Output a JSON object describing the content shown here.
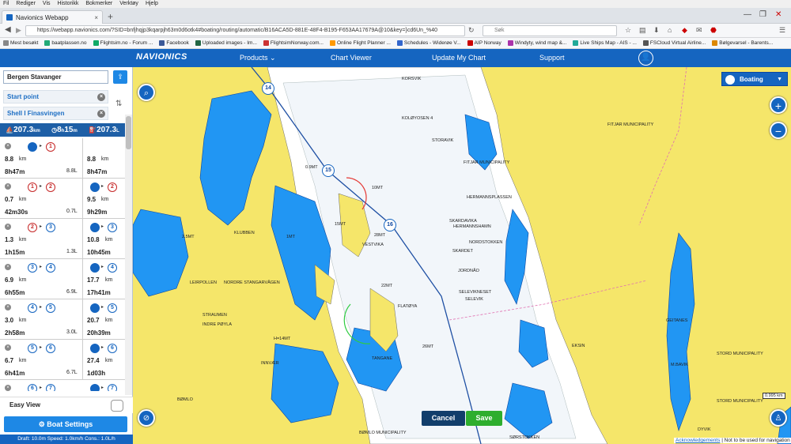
{
  "browser": {
    "menu": [
      "Fil",
      "Rediger",
      "Vis",
      "Historikk",
      "Bokmerker",
      "Verktøy",
      "Hjelp"
    ],
    "tab_title": "Navionics Webapp",
    "url": "https://webapp.navionics.com/?SID=bnfjhqjp3kqarpjh63m0d6otk4#boating/routing/automatic/B16ACA5D-881E-48F4-B195-F653AA17679A@10&key=}cd6Un_%40",
    "search_placeholder": "Søk",
    "bookmarks": [
      "Mest besøkt",
      "baatplassen.no",
      "Flightsim.no - Forum ...",
      "Facebook",
      "Uploaded images - Im...",
      "FlightsimNorway.com...",
      "Online Flight Planner ...",
      "Schedules - Widerøe V...",
      "AIP Norway",
      "Windyty, wind map &...",
      "Live Ships Map - AIS - ...",
      "FSCloud Virtual Airline...",
      "Bølgevarsel - Barents..."
    ]
  },
  "header": {
    "logo": "NAVIONICS",
    "nav": [
      "Products",
      "Chart Viewer",
      "Update My Chart",
      "Support"
    ]
  },
  "sidebar": {
    "route_name": "Bergen Stavanger",
    "start_point": "Start point",
    "end_point": "Shell I Finasvingen",
    "totals": {
      "distance": "207.3",
      "distance_unit": "km",
      "time_h": "8",
      "time_m": "15",
      "time_unit_h": "h",
      "fuel": "207.3",
      "fuel_unit": "L"
    },
    "legs": [
      {
        "from": "start",
        "to": "1",
        "dist": "8.8",
        "time": "8h47m",
        "fuel": "8.8L",
        "cum_dist": "8.8",
        "cum_time": "8h47m"
      },
      {
        "from": "1",
        "to": "2",
        "dist": "0.7",
        "time": "42m30s",
        "fuel": "0.7L",
        "cum_dist": "9.5",
        "cum_time": "9h29m"
      },
      {
        "from": "2",
        "to": "3",
        "dist": "1.3",
        "time": "1h15m",
        "fuel": "1.3L",
        "cum_dist": "10.8",
        "cum_time": "10h45m"
      },
      {
        "from": "3",
        "to": "4",
        "dist": "6.9",
        "time": "6h55m",
        "fuel": "6.9L",
        "cum_dist": "17.7",
        "cum_time": "17h41m"
      },
      {
        "from": "4",
        "to": "5",
        "dist": "3.0",
        "time": "2h58m",
        "fuel": "3.0L",
        "cum_dist": "20.7",
        "cum_time": "20h39m"
      },
      {
        "from": "5",
        "to": "6",
        "dist": "6.7",
        "time": "6h41m",
        "fuel": "6.7L",
        "cum_dist": "27.4",
        "cum_time": "1d03h"
      },
      {
        "from": "6",
        "to": "7",
        "dist": "",
        "time": "",
        "fuel": "",
        "cum_dist": "",
        "cum_time": ""
      }
    ],
    "easy_view": "Easy View",
    "boat_settings": "Boat Settings",
    "footer": "Draft: 10.0m Speed: 1.0km/h Cons.: 1.0L/h"
  },
  "map": {
    "mode": "Boating",
    "waypoints": [
      "14",
      "15",
      "16"
    ],
    "cancel": "Cancel",
    "save": "Save",
    "ack_link": "Acknowledgements",
    "ack_text": "| Not to be used for navigation",
    "scale": "0.995 km",
    "labels": [
      "KORSVIK",
      "KOLØYOSEN 4",
      "STORAVIK",
      "FITJAR MUNICIPALITY",
      "FITJAR MUNICIPALITY",
      "HERMANNSPLASSEN",
      "SKARDAVIKA",
      "HERMANNSHAMN",
      "NORDSTOKKEN",
      "SKARDET",
      "JORDNÅO",
      "SELEVIKNESET",
      "SELEVIK",
      "KLUBBEN",
      "NORDRE STANGARVÅGEN",
      "LEIRPOLLEN",
      "STRAUMEN",
      "INDRE PØYLA",
      "FLATØYA",
      "VESTVIKA",
      "TANGANE",
      "INNVÆR",
      "BØMLO",
      "BØMLO MUNICIPALITY",
      "STORD MUNICIPALITY",
      "STORD MUNICIPALITY",
      "M.BAVIK",
      "GEITANES",
      "DYVIK",
      "SØRSTOKKEN",
      "EKSIN",
      "2.5MT",
      "1MT",
      "0.9MT",
      "15MT",
      "10MT",
      "22MT",
      "28MT",
      "26MT",
      "H=14MT"
    ]
  },
  "colors": {
    "accent": "#1565c0",
    "land": "#f5e66a",
    "water": "#ffffff",
    "shallow": "#2196f3",
    "route": "#1e4fa3"
  }
}
